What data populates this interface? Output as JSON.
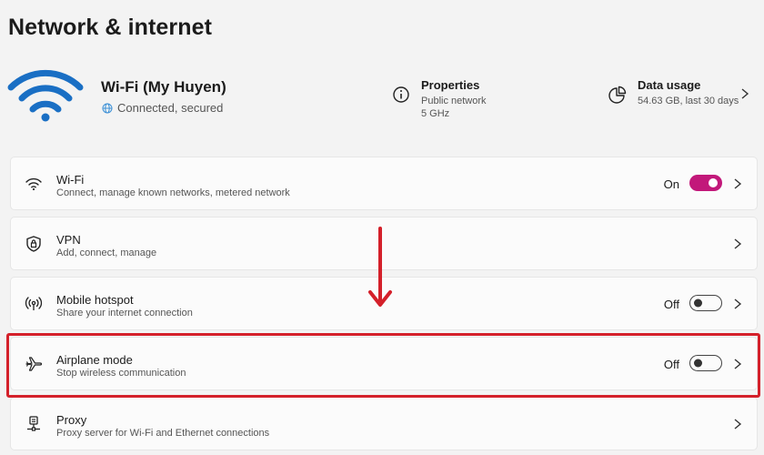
{
  "page": {
    "title": "Network & internet"
  },
  "hero": {
    "network_name": "Wi-Fi (My Huyen)",
    "status": "Connected, secured",
    "wifi_icon": "wifi-large-icon",
    "wifi_color": "#1a6fc4"
  },
  "properties": {
    "title": "Properties",
    "line1": "Public network",
    "line2": "5 GHz",
    "icon": "info-icon"
  },
  "data_usage": {
    "title": "Data usage",
    "line1": "54.63 GB, last 30 days",
    "icon": "pie-chart-icon"
  },
  "settings": [
    {
      "title": "Wi-Fi",
      "subtitle": "Connect, manage known networks, metered network",
      "state": "On",
      "toggle": "on",
      "icon": "wifi-icon"
    },
    {
      "title": "VPN",
      "subtitle": "Add, connect, manage",
      "icon": "shield-icon"
    },
    {
      "title": "Mobile hotspot",
      "subtitle": "Share your internet connection",
      "state": "Off",
      "toggle": "off",
      "icon": "hotspot-icon"
    },
    {
      "title": "Airplane mode",
      "subtitle": "Stop wireless communication",
      "state": "Off",
      "toggle": "off",
      "icon": "airplane-icon"
    },
    {
      "title": "Proxy",
      "subtitle": "Proxy server for Wi-Fi and Ethernet connections",
      "icon": "proxy-icon"
    }
  ],
  "colors": {
    "accent": "#c2187a",
    "annotation": "#d4202a"
  }
}
